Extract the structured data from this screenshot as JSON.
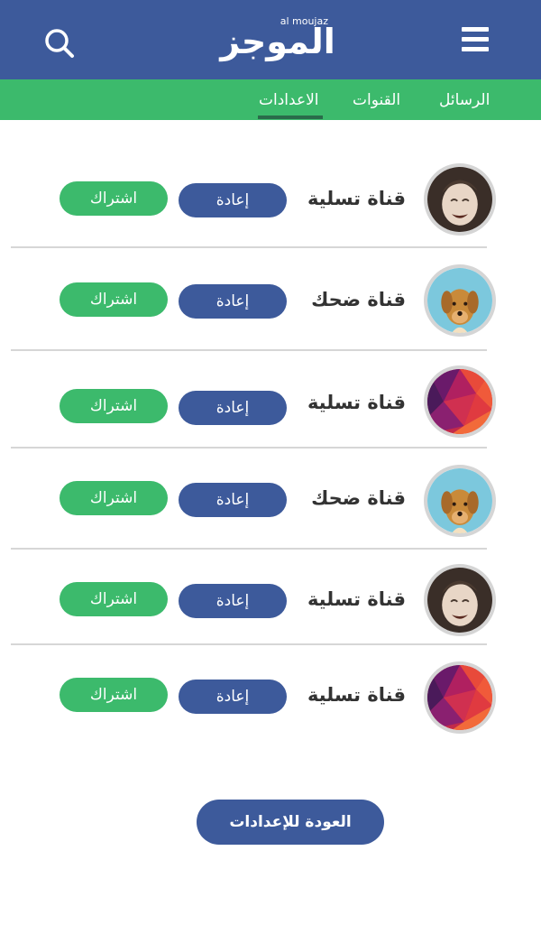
{
  "header": {
    "logo_text": "الموجز",
    "logo_subtext": "al moujaz",
    "bg_color": "#3d5a9b",
    "menu_icon": "hamburger-menu-icon",
    "search_icon": "search-icon"
  },
  "tabs": [
    {
      "label": "الرسائل",
      "active": false
    },
    {
      "label": "القنوات",
      "active": false
    },
    {
      "label": "الاعدادات",
      "active": true
    }
  ],
  "tabbar_color": "#3cba6c",
  "channels": [
    {
      "name": "قناة تسلية",
      "avatar": "laughing-child",
      "replay_label": "إعادة",
      "subscribe_label": "اشتراك"
    },
    {
      "name": "قناة ضحك",
      "avatar": "dog",
      "replay_label": "إعادة",
      "subscribe_label": "اشتراك"
    },
    {
      "name": "قناة تسلية",
      "avatar": "polygon-art",
      "replay_label": "إعادة",
      "subscribe_label": "اشتراك"
    },
    {
      "name": "قناة ضحك",
      "avatar": "dog",
      "replay_label": "إعادة",
      "subscribe_label": "اشتراك"
    },
    {
      "name": "قناة تسلية",
      "avatar": "laughing-child",
      "replay_label": "إعادة",
      "subscribe_label": "اشتراك"
    },
    {
      "name": "قناة تسلية",
      "avatar": "polygon-art",
      "replay_label": "إعادة",
      "subscribe_label": "اشتراك"
    }
  ],
  "back_button_label": "العودة للإعدادات",
  "colors": {
    "primary": "#3d5a9b",
    "accent": "#3cba6c"
  }
}
